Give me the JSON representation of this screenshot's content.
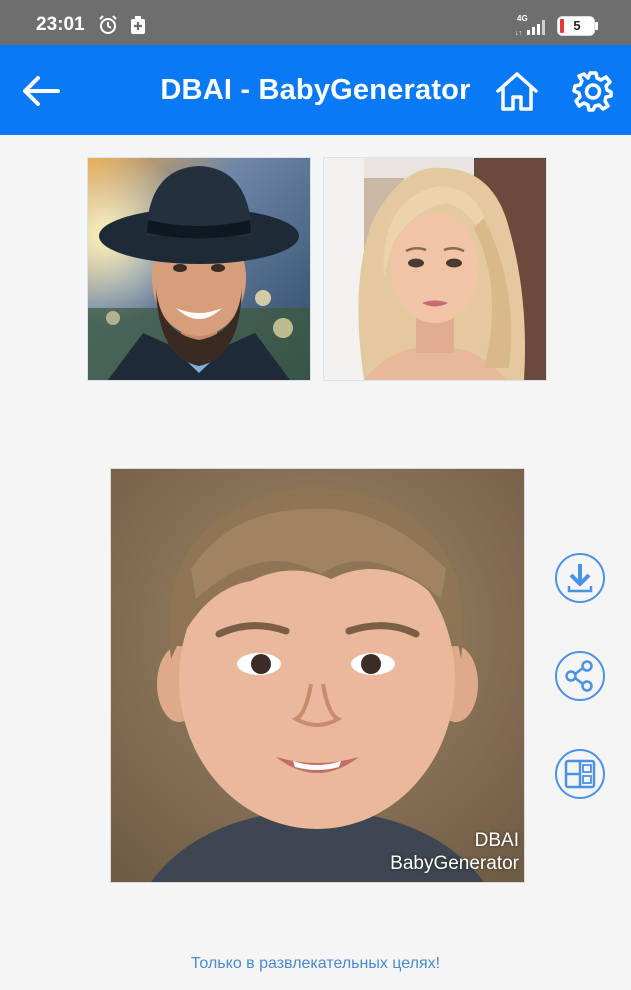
{
  "status_bar": {
    "time": "23:01",
    "network": "4G",
    "battery": "5"
  },
  "app_bar": {
    "title": "DBAI - BabyGenerator"
  },
  "result": {
    "watermark_line1": "DBAI",
    "watermark_line2": "BabyGenerator"
  },
  "footer": {
    "disclaimer": "Только в развлекательных целях!"
  },
  "colors": {
    "app_bar": "#0a79f6",
    "status_bar": "#6e6e6e",
    "accent": "#4a92e4",
    "background": "#f5f5f5"
  },
  "icons": {
    "back": "arrow-left-icon",
    "home": "home-icon",
    "settings": "gear-icon",
    "download": "download-icon",
    "share": "share-icon",
    "compare": "compare-icon"
  }
}
